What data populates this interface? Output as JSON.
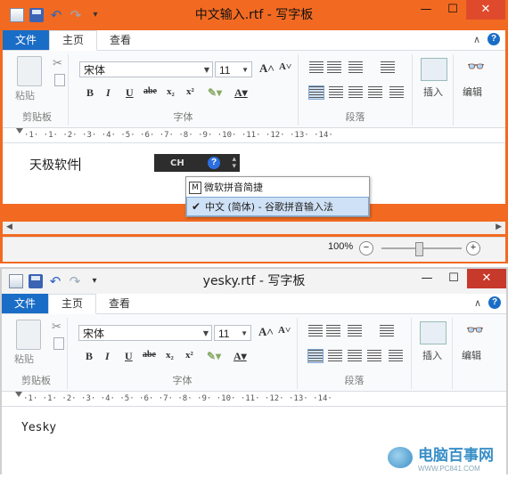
{
  "window1": {
    "title": "中文输入.rtf - 写字板",
    "tabs": {
      "file": "文件",
      "home": "主页",
      "view": "查看"
    },
    "ribbon": {
      "paste": "粘贴",
      "clipboard": "剪贴板",
      "font_name": "宋体",
      "font_size": "11",
      "font_group": "字体",
      "paragraph_group": "段落",
      "insert": "插入",
      "edit": "编辑"
    },
    "doc_text": "天极软件",
    "ime": {
      "bar_label": "CH",
      "help": "?",
      "menu": [
        {
          "lead": "M",
          "label": "微软拼音简捷"
        },
        {
          "lead": "✔",
          "label": "中文 (简体) - 谷歌拼音输入法",
          "selected": true
        }
      ]
    },
    "zoom": "100%"
  },
  "window2": {
    "title": "yesky.rtf - 写字板",
    "tabs": {
      "file": "文件",
      "home": "主页",
      "view": "查看"
    },
    "ribbon": {
      "paste": "粘贴",
      "clipboard": "剪贴板",
      "font_name": "宋体",
      "font_size": "11",
      "font_group": "字体",
      "paragraph_group": "段落",
      "insert": "插入",
      "edit": "编辑"
    },
    "doc_text": "Yesky"
  },
  "ruler_text": "·1·  ·1·  ·2·  ·3·  ·4·  ·5·  ·6·  ·7·  ·8·  ·9·  ·10·  ·11·  ·12·  ·13·  ·14·",
  "watermark": {
    "title": "电脑百事网",
    "url": "WWW.PC841.COM"
  },
  "colors": {
    "accent_orange": "#f26a21",
    "file_tab_blue": "#1a6dc6"
  }
}
